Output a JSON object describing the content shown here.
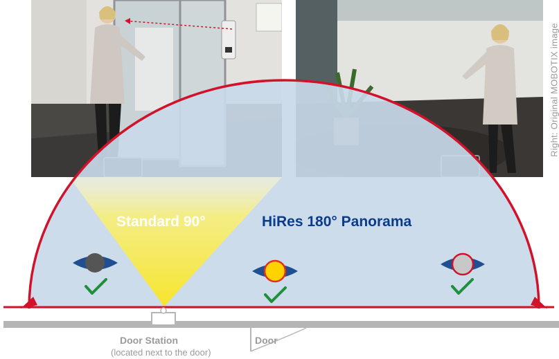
{
  "images": {
    "left_photo": "photo: woman opening glass door next to wall-mounted door station",
    "right_photo": "photo: woman in lobby seen through 180° panorama lens"
  },
  "caption_vertical": "Right: Original MOBOTIX image",
  "labels": {
    "standard": "Standard 90°",
    "hires": "HiRes 180° Panorama",
    "door_station": "Door Station",
    "door_station_note": "(located next to the door)",
    "door": "Door"
  },
  "colors": {
    "arc_red": "#d0122b",
    "semicircle_fill": "#c9d9e8",
    "cone_yellow": "#f6e52d",
    "eye_blue": "#1f4f91",
    "hires_text": "#0a3b8c",
    "check_green": "#1e8f3a",
    "wall_gray": "#b5b5b5"
  },
  "eyes": [
    {
      "name": "eye-left",
      "iris": "#555555",
      "ring": "#555555"
    },
    {
      "name": "eye-center",
      "iris": "#ffd200",
      "ring": "#e0301e"
    },
    {
      "name": "eye-right",
      "iris": "#c8c8c8",
      "ring": "#d0122b"
    }
  ],
  "icons": [
    "check-icon",
    "check-icon",
    "check-icon",
    "arrow-left-icon",
    "arrow-right-icon"
  ]
}
